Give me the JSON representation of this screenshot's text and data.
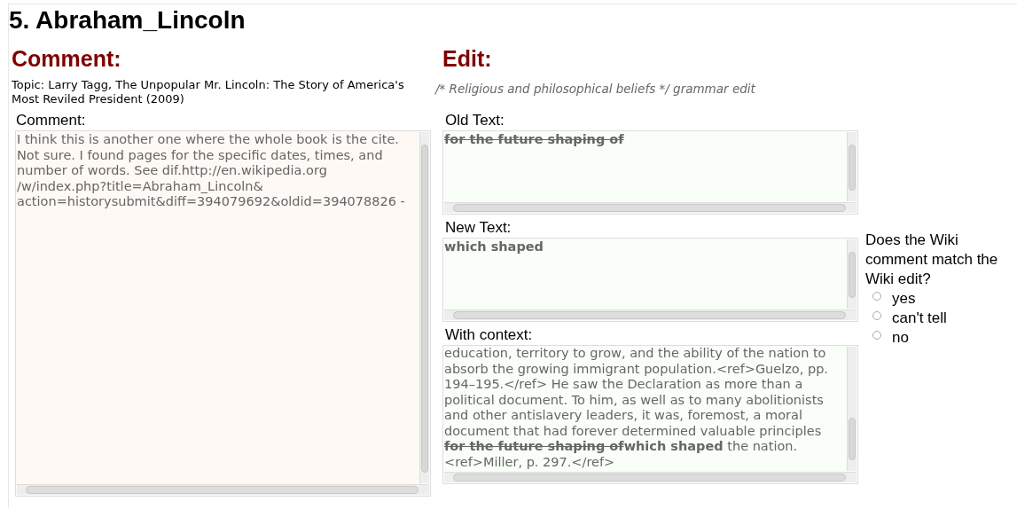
{
  "title": "5. Abraham_Lincoln",
  "comment_section": {
    "heading": "Comment:",
    "topic": "Topic: Larry Tagg, The Unpopular Mr. Lincoln: The Story of America's Most Reviled President (2009)",
    "field_label": "Comment:",
    "field_value": "I think this is another one where the whole book is the cite. Not sure. I found pages for the specific dates, times, and number of words. See dif.http://en.wikipedia.org /w/index.php?title=Abraham_Lincoln& action=historysubmit&diff=394079692&oldid=394078826 -"
  },
  "edit_section": {
    "heading": "Edit:",
    "summary": "/* Religious and philosophical beliefs */ grammar edit",
    "old_label": "Old Text:",
    "old_value": "for the future shaping of",
    "new_label": "New Text:",
    "new_value": "which shaped",
    "context_label": "With context:",
    "context": [
      {
        "kind": "plain",
        "text": "education, territory to grow, and the ability of the nation to absorb the growing immigrant population.<ref>Guelzo, pp. 194–195.</ref> He saw the Declaration as more than a political document. To him, as well as to many abolitionists and other antislavery leaders, it was, foremost, a moral document that had forever determined valuable principles "
      },
      {
        "kind": "deleted",
        "text": "for the future shaping of"
      },
      {
        "kind": "inserted",
        "text": "which shaped"
      },
      {
        "kind": "plain",
        "text": " the nation. <ref>Miller, p. 297.</ref>"
      }
    ]
  },
  "question": {
    "text": "Does the Wiki comment match the Wiki edit?",
    "options": [
      {
        "label": "yes",
        "selected": false
      },
      {
        "label": "can't tell",
        "selected": false
      },
      {
        "label": "no",
        "selected": false
      }
    ]
  }
}
